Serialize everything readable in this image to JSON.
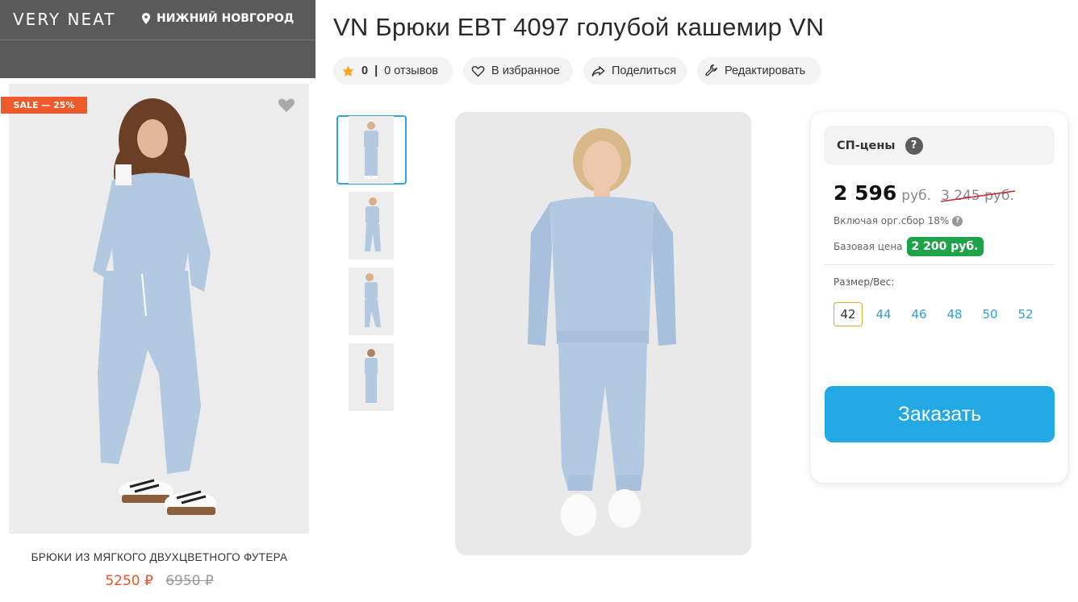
{
  "ad": {
    "brand": "VERY NEAT",
    "city": "НИЖНИЙ НОВГОРОД",
    "sale_badge": "SALE — 25%",
    "title": "БРЮКИ ИЗ МЯГКОГО ДВУХЦВЕТНОГО ФУТЕРА",
    "price_new": "5250 ₽",
    "price_old": "6950 ₽"
  },
  "product": {
    "title": "VN Брюки EBT 4097 голубой кашемир VN",
    "rating": "0",
    "reviews": "0 отзывов",
    "favorite_label": "В избранное",
    "share_label": "Поделиться",
    "edit_label": "Редактировать",
    "thumbnail_count": 4
  },
  "card": {
    "heading": "СП-цены",
    "price": "2 596",
    "currency": "руб.",
    "price_old": "3 245 руб.",
    "fee_note": "Включая орг.сбор 18%",
    "base_label": "Базовая цена",
    "base_price": "2 200 руб.",
    "size_label": "Размер/Вес:",
    "sizes": [
      "42",
      "44",
      "46",
      "48",
      "50",
      "52"
    ],
    "selected_size": "42",
    "order_button": "Заказать"
  },
  "colors": {
    "accent_blue": "#22a8e3",
    "sale_orange": "#ee5a2c",
    "base_green": "#1fa24a",
    "star": "#f5a623"
  }
}
